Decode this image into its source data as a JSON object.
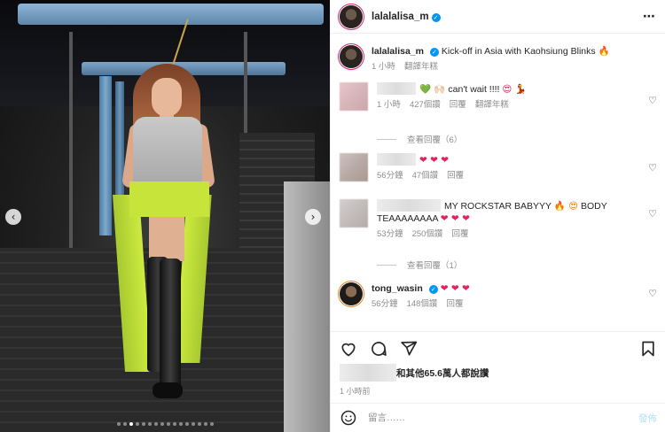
{
  "post": {
    "username": "lalalalisa_m",
    "caption": "Kick-off in Asia with Kaohsiung Blinks",
    "caption_emoji": "🔥",
    "time": "1 小時",
    "translate": "翻譯年糕"
  },
  "carousel": {
    "prev": "‹",
    "next": "›",
    "total_slides": 16,
    "active_slide": 3
  },
  "comments": [
    {
      "text": "can't wait !!!!",
      "emoji_before": "💚 🙌🏻",
      "emoji_after": "😍 💃",
      "time": "1 小時",
      "likes": "427個讚",
      "reply": "回覆",
      "translate": "翻譯年糕",
      "view_replies": "查看回覆（6）"
    },
    {
      "emoji": "❤ ❤ ❤",
      "time": "56分鐘",
      "likes": "47個讚",
      "reply": "回覆"
    },
    {
      "text": "MY ROCKSTAR BABYYY",
      "emoji_mid": "🔥 😍",
      "text2": "BODY TEAAAAAAAA",
      "emoji_end": "❤ ❤ ❤",
      "time": "53分鐘",
      "likes": "250個讚",
      "reply": "回覆",
      "view_replies": "查看回覆（1）"
    },
    {
      "username": "tong_wasin",
      "emoji": "❤ ❤ ❤",
      "time": "56分鐘",
      "likes": "148個讚",
      "reply": "回覆"
    }
  ],
  "likes_summary": "和其他65.6萬人都說讚",
  "post_time": "1 小時前",
  "compose": {
    "placeholder": "留言……",
    "post_label": "發佈",
    "post_color": "#b2dffc"
  },
  "icons": {
    "more": "⋯",
    "heart": "♡"
  }
}
